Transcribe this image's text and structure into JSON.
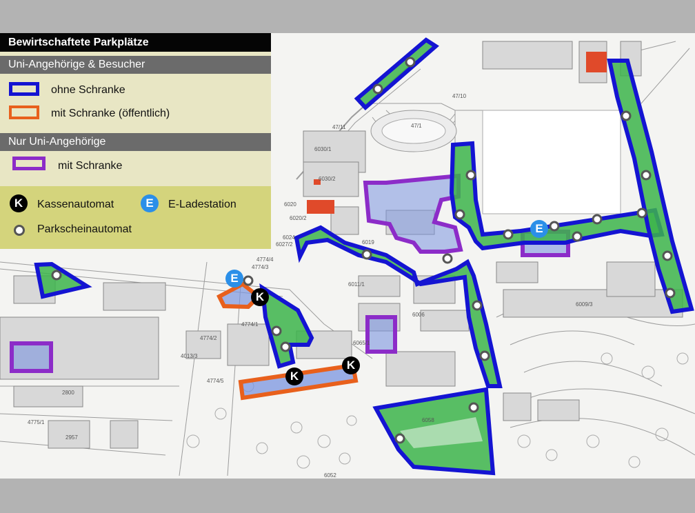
{
  "legend": {
    "title": "Bewirtschaftete Parkplätze",
    "section_visitors": "Uni-Angehörige & Besucher",
    "item_no_barrier": "ohne Schranke",
    "item_barrier_public": "mit Schranke (öffentlich)",
    "section_members": "Nur Uni-Angehörige",
    "item_barrier_members": "mit Schranke",
    "cash_machine_letter": "K",
    "cash_machine_label": "Kassenautomat",
    "ev_station_letter": "E",
    "ev_station_label": "E-Ladestation",
    "ticket_machine_label": "Parkscheinautomat"
  },
  "colors": {
    "no_barrier": "#1414d2",
    "barrier_public": "#e8601c",
    "barrier_members": "#8c2cc8",
    "parking_fill": "#3cb44b",
    "ev_station": "#2b8fe8",
    "cash_machine": "#000000",
    "ticket_machine": "#555555"
  },
  "map_labels": [
    "47/1",
    "47/10",
    "47/11",
    "6030/1",
    "6030/2",
    "6020/2",
    "6020",
    "6024",
    "6027/2",
    "4774/4",
    "4774/3",
    "4774/1",
    "4774/2",
    "4774/5",
    "4013/3",
    "4775/1",
    "6052",
    "6011/1",
    "6006",
    "6009/3",
    "6058",
    "6065/1",
    "2800",
    "2957",
    "6019"
  ]
}
